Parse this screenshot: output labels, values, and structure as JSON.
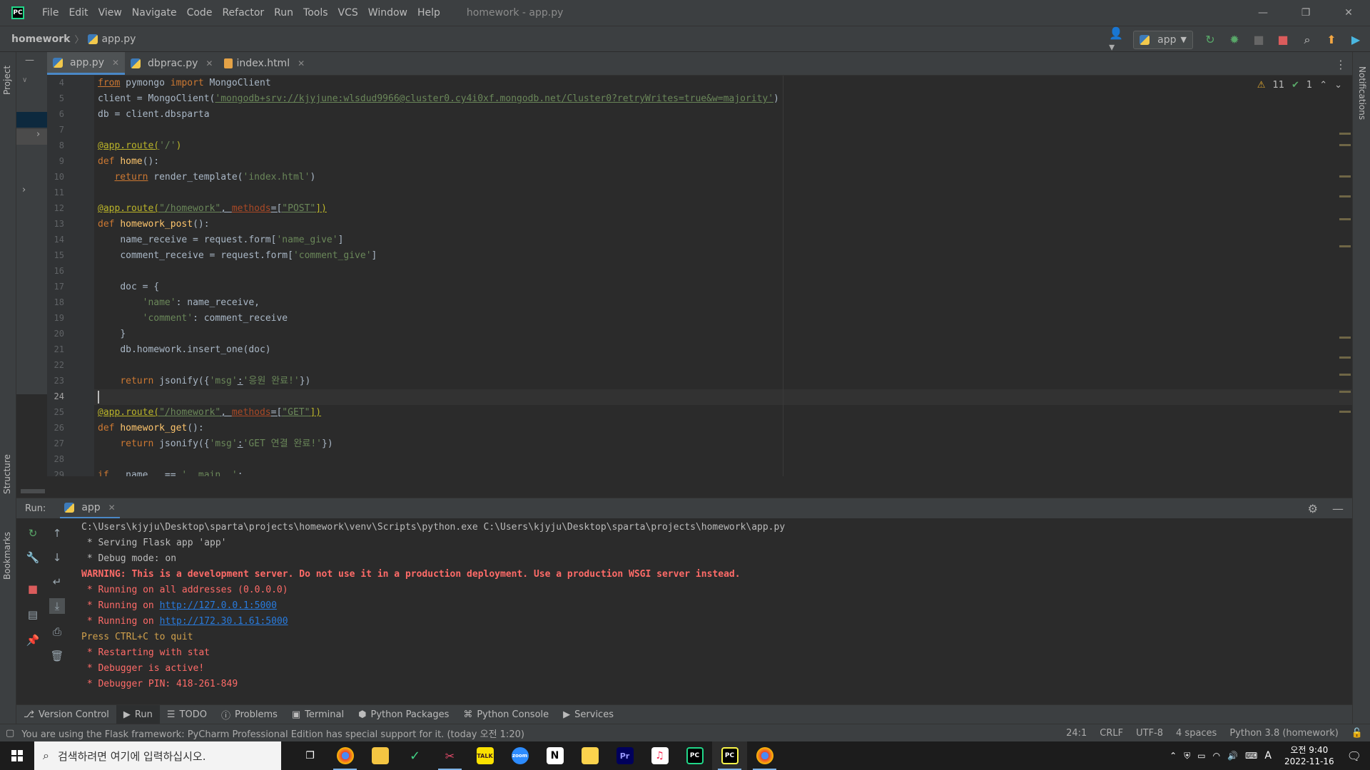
{
  "menu": {
    "items": [
      "File",
      "Edit",
      "View",
      "Navigate",
      "Code",
      "Refactor",
      "Run",
      "Tools",
      "VCS",
      "Window",
      "Help"
    ],
    "window_title": "homework - app.py"
  },
  "navbar": {
    "project": "homework",
    "file": "app.py",
    "run_config": "app"
  },
  "left_strip": {
    "project": "Project",
    "structure": "Structure",
    "bookmarks": "Bookmarks"
  },
  "right_strip": {
    "notifications": "Notifications"
  },
  "tabs": [
    {
      "label": "app.py",
      "active": true
    },
    {
      "label": "dbprac.py",
      "active": false
    },
    {
      "label": "index.html",
      "active": false
    }
  ],
  "inspections": {
    "warnings": "11",
    "ok": "1"
  },
  "editor": {
    "line_numbers": [
      "4",
      "5",
      "6",
      "7",
      "8",
      "9",
      "10",
      "11",
      "12",
      "13",
      "14",
      "15",
      "16",
      "17",
      "18",
      "19",
      "20",
      "21",
      "22",
      "23",
      "24",
      "25",
      "26",
      "27",
      "28",
      "29"
    ],
    "current_line": "24",
    "lines": {
      "l4_a": "from",
      "l4_b": " pymongo ",
      "l4_c": "import",
      "l4_d": " MongoClient",
      "l5_a": "client = MongoClient(",
      "l5_b": "'mongodb+srv://kjyjune:wlsdud9966@cluster0.cy4i0xf.mongodb.net/Cluster0?retryWrites=true&w=majority'",
      "l5_c": ")",
      "l6": "db = client.dbsparta",
      "l8_a": "@app.route(",
      "l8_b": "'/'",
      "l8_c": ")",
      "l9_a": "def",
      "l9_b": "home",
      "l9_c": "():",
      "l10_a": "return",
      "l10_b": " render_template(",
      "l10_c": "'index.html'",
      "l10_d": ")",
      "l12_a": "@app.route(",
      "l12_b": "\"/homework\"",
      "l12_c": ", ",
      "l12_d": "methods",
      "l12_e": "=[",
      "l12_f": "\"POST\"",
      "l12_g": "])",
      "l13_a": "def",
      "l13_b": "homework_post",
      "l13_c": "():",
      "l14_a": "name_receive = request.form[",
      "l14_b": "'name_give'",
      "l14_c": "]",
      "l15_a": "comment_receive = request.form[",
      "l15_b": "'comment_give'",
      "l15_c": "]",
      "l17": "doc = {",
      "l18_a": "'name'",
      "l18_b": ": name_receive,",
      "l19_a": "'comment'",
      "l19_b": ": comment_receive",
      "l20": "}",
      "l21": "db.homework.insert_one(doc)",
      "l23_a": "return",
      "l23_b": " jsonify({",
      "l23_c": "'msg'",
      "l23_d": ":",
      "l23_e": "'응원 완료!'",
      "l23_f": "})",
      "l25_a": "@app.route(",
      "l25_b": "\"/homework\"",
      "l25_c": ", ",
      "l25_d": "methods",
      "l25_e": "=[",
      "l25_f": "\"GET\"",
      "l25_g": "])",
      "l26_a": "def",
      "l26_b": "homework_get",
      "l26_c": "():",
      "l27_a": "return",
      "l27_b": " jsonify({",
      "l27_c": "'msg'",
      "l27_d": ":",
      "l27_e": "'GET 연결 완료!'",
      "l27_f": "})",
      "l29_a": "if",
      "l29_b": " __name__ == ",
      "l29_c": "'__main__'",
      "l29_d": ":"
    }
  },
  "run": {
    "label": "Run:",
    "tab": "app",
    "console": {
      "c1": "C:\\Users\\kjyju\\Desktop\\sparta\\projects\\homework\\venv\\Scripts\\python.exe C:\\Users\\kjyju\\Desktop\\sparta\\projects\\homework\\app.py",
      "c2": " * Serving Flask app 'app'",
      "c3": " * Debug mode: on",
      "c4": "WARNING: This is a development server. Do not use it in a production deployment. Use a production WSGI server instead.",
      "c5": " * Running on all addresses (0.0.0.0)",
      "c6a": " * Running on ",
      "c6b": "http://127.0.0.1:5000",
      "c7a": " * Running on ",
      "c7b": "http://172.30.1.61:5000",
      "c8": "Press CTRL+C to quit",
      "c9": " * Restarting with stat",
      "c10": " * Debugger is active!",
      "c11": " * Debugger PIN: 418-261-849"
    }
  },
  "bottom_tools": [
    "Version Control",
    "Run",
    "TODO",
    "Problems",
    "Terminal",
    "Python Packages",
    "Python Console",
    "Services"
  ],
  "status": {
    "message": "You are using the Flask framework: PyCharm Professional Edition has special support for it. (today 오전 1:20)",
    "position": "24:1",
    "line_sep": "CRLF",
    "encoding": "UTF-8",
    "indent": "4 spaces",
    "interpreter": "Python 3.8 (homework)"
  },
  "taskbar": {
    "search_placeholder": "검색하려면 여기에 입력하십시오.",
    "time": "오전 9:40",
    "date": "2022-11-16",
    "ime": "A"
  },
  "colors": {
    "accent": "#4a88c7",
    "keyword": "#cc7832",
    "string": "#6a8759",
    "warning": "#ff6b68"
  }
}
